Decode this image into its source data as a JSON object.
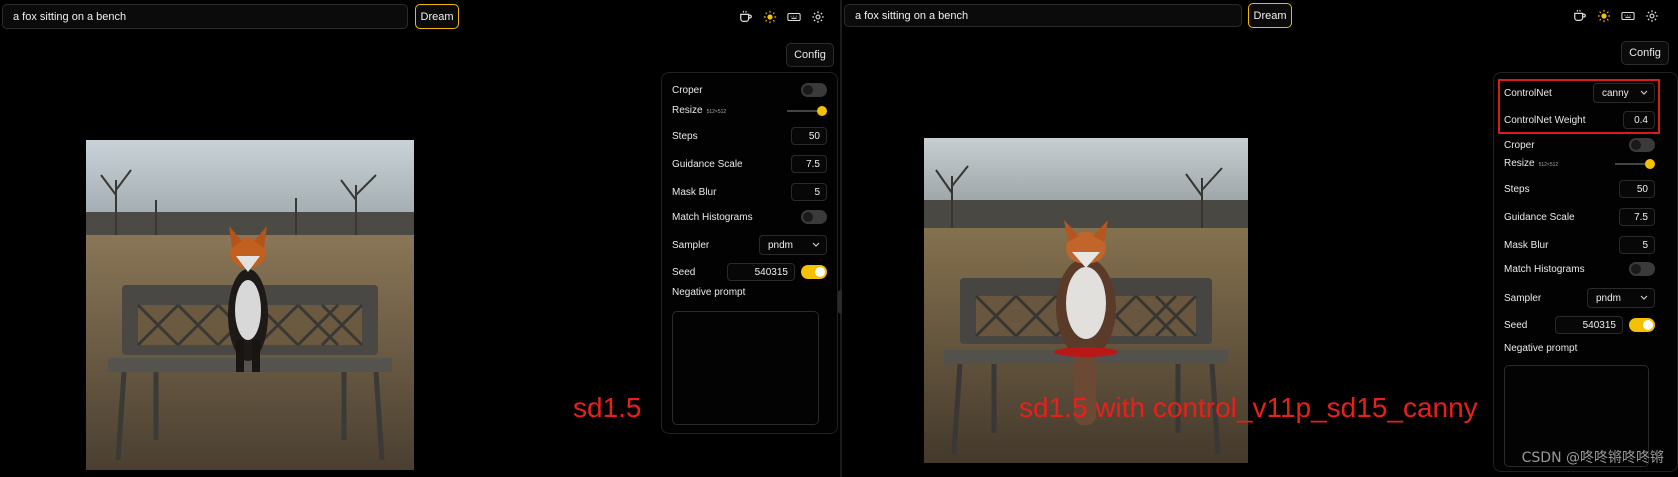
{
  "left": {
    "prompt": "a fox sitting on a bench",
    "dream_label": "Dream",
    "config_label": "Config",
    "settings": {
      "croper_label": "Croper",
      "resize_label": "Resize",
      "resize_size": "512×512",
      "steps_label": "Steps",
      "steps": "50",
      "guidance_label": "Guidance Scale",
      "guidance": "7.5",
      "mask_blur_label": "Mask Blur",
      "mask_blur": "5",
      "match_hist_label": "Match Histograms",
      "sampler_label": "Sampler",
      "sampler": "pndm",
      "seed_label": "Seed",
      "seed": "540315",
      "negative_label": "Negative prompt"
    },
    "caption": "sd1.5"
  },
  "right": {
    "prompt": "a fox sitting on a bench",
    "dream_label": "Dream",
    "config_label": "Config",
    "settings": {
      "controlnet_label": "ControlNet",
      "controlnet": "canny",
      "controlnet_weight_label": "ControlNet Weight",
      "controlnet_weight": "0.4",
      "croper_label": "Croper",
      "resize_label": "Resize",
      "resize_size": "512×512",
      "steps_label": "Steps",
      "steps": "50",
      "guidance_label": "Guidance Scale",
      "guidance": "7.5",
      "mask_blur_label": "Mask Blur",
      "mask_blur": "5",
      "match_hist_label": "Match Histograms",
      "sampler_label": "Sampler",
      "sampler": "pndm",
      "seed_label": "Seed",
      "seed": "540315",
      "negative_label": "Negative prompt"
    },
    "caption": "sd1.5 with control_v11p_sd15_canny"
  },
  "watermark": "CSDN @咚咚锵咚咚锵",
  "icons": [
    "coffee-icon",
    "sun-icon",
    "keyboard-icon",
    "gear-icon"
  ],
  "colors": {
    "accent": "#f5c000",
    "caption": "#e8201c",
    "background": "#000000"
  },
  "toggles": {
    "croper": false,
    "match_histograms": false,
    "seed": true
  },
  "resize_level": 1.0
}
